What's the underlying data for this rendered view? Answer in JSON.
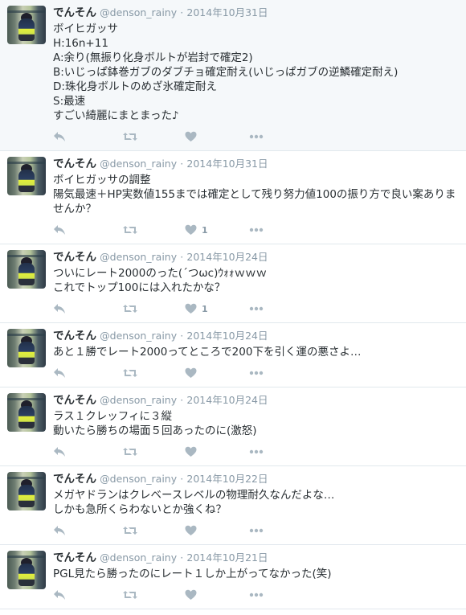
{
  "tweets": [
    {
      "name": "でんそん",
      "handle": "@denson_rainy",
      "date": "2014年10月31日",
      "text": "ボイヒガッサ\nH:16n+11\nA:余り(無振り化身ボルトが岩封で確定2)\nB:いじっぱ鉢巻ガブのダブチョ確定耐え(いじっぱガブの逆鱗確定耐え)\nD:珠化身ボルトのめざ氷確定耐え\nS:最速\nすごい綺麗にまとまった♪",
      "likes": "",
      "highlight": true
    },
    {
      "name": "でんそん",
      "handle": "@denson_rainy",
      "date": "2014年10月31日",
      "text": "ボイヒガッサの調整\n陽気最速＋HP実数値155までは確定として残り努力値100の振り方で良い案ありませんか？",
      "likes": "1",
      "highlight": false
    },
    {
      "name": "でんそん",
      "handle": "@denson_rainy",
      "date": "2014年10月24日",
      "text": "ついにレート2000のった(´つωc)ｳｫｫｗｗｗ\nこれでトップ100には入れたかな？",
      "likes": "1",
      "highlight": false
    },
    {
      "name": "でんそん",
      "handle": "@denson_rainy",
      "date": "2014年10月24日",
      "text": "あと１勝でレート2000ってところで200下を引く運の悪さよ…",
      "likes": "",
      "highlight": false
    },
    {
      "name": "でんそん",
      "handle": "@denson_rainy",
      "date": "2014年10月24日",
      "text": "ラス１クレッフィに３縦\n動いたら勝ちの場面５回あったのに(激怒)",
      "likes": "",
      "highlight": false
    },
    {
      "name": "でんそん",
      "handle": "@denson_rainy",
      "date": "2014年10月22日",
      "text": "メガヤドランはクレベースレベルの物理耐久なんだよな…\nしかも急所くらわないとか強くね？",
      "likes": "",
      "highlight": false
    },
    {
      "name": "でんそん",
      "handle": "@denson_rainy",
      "date": "2014年10月21日",
      "text": "PGL見たら勝ったのにレート１しか上がってなかった(笑)",
      "likes": "",
      "highlight": false
    }
  ],
  "icons": {
    "reply": "reply-icon",
    "retweet": "retweet-icon",
    "like": "heart-icon",
    "more": "more-icon"
  },
  "colors": {
    "icon": "#aab8c2",
    "meta": "#8899a6",
    "highlight_bg": "#f5f8fa",
    "divider": "#e1e8ed"
  }
}
